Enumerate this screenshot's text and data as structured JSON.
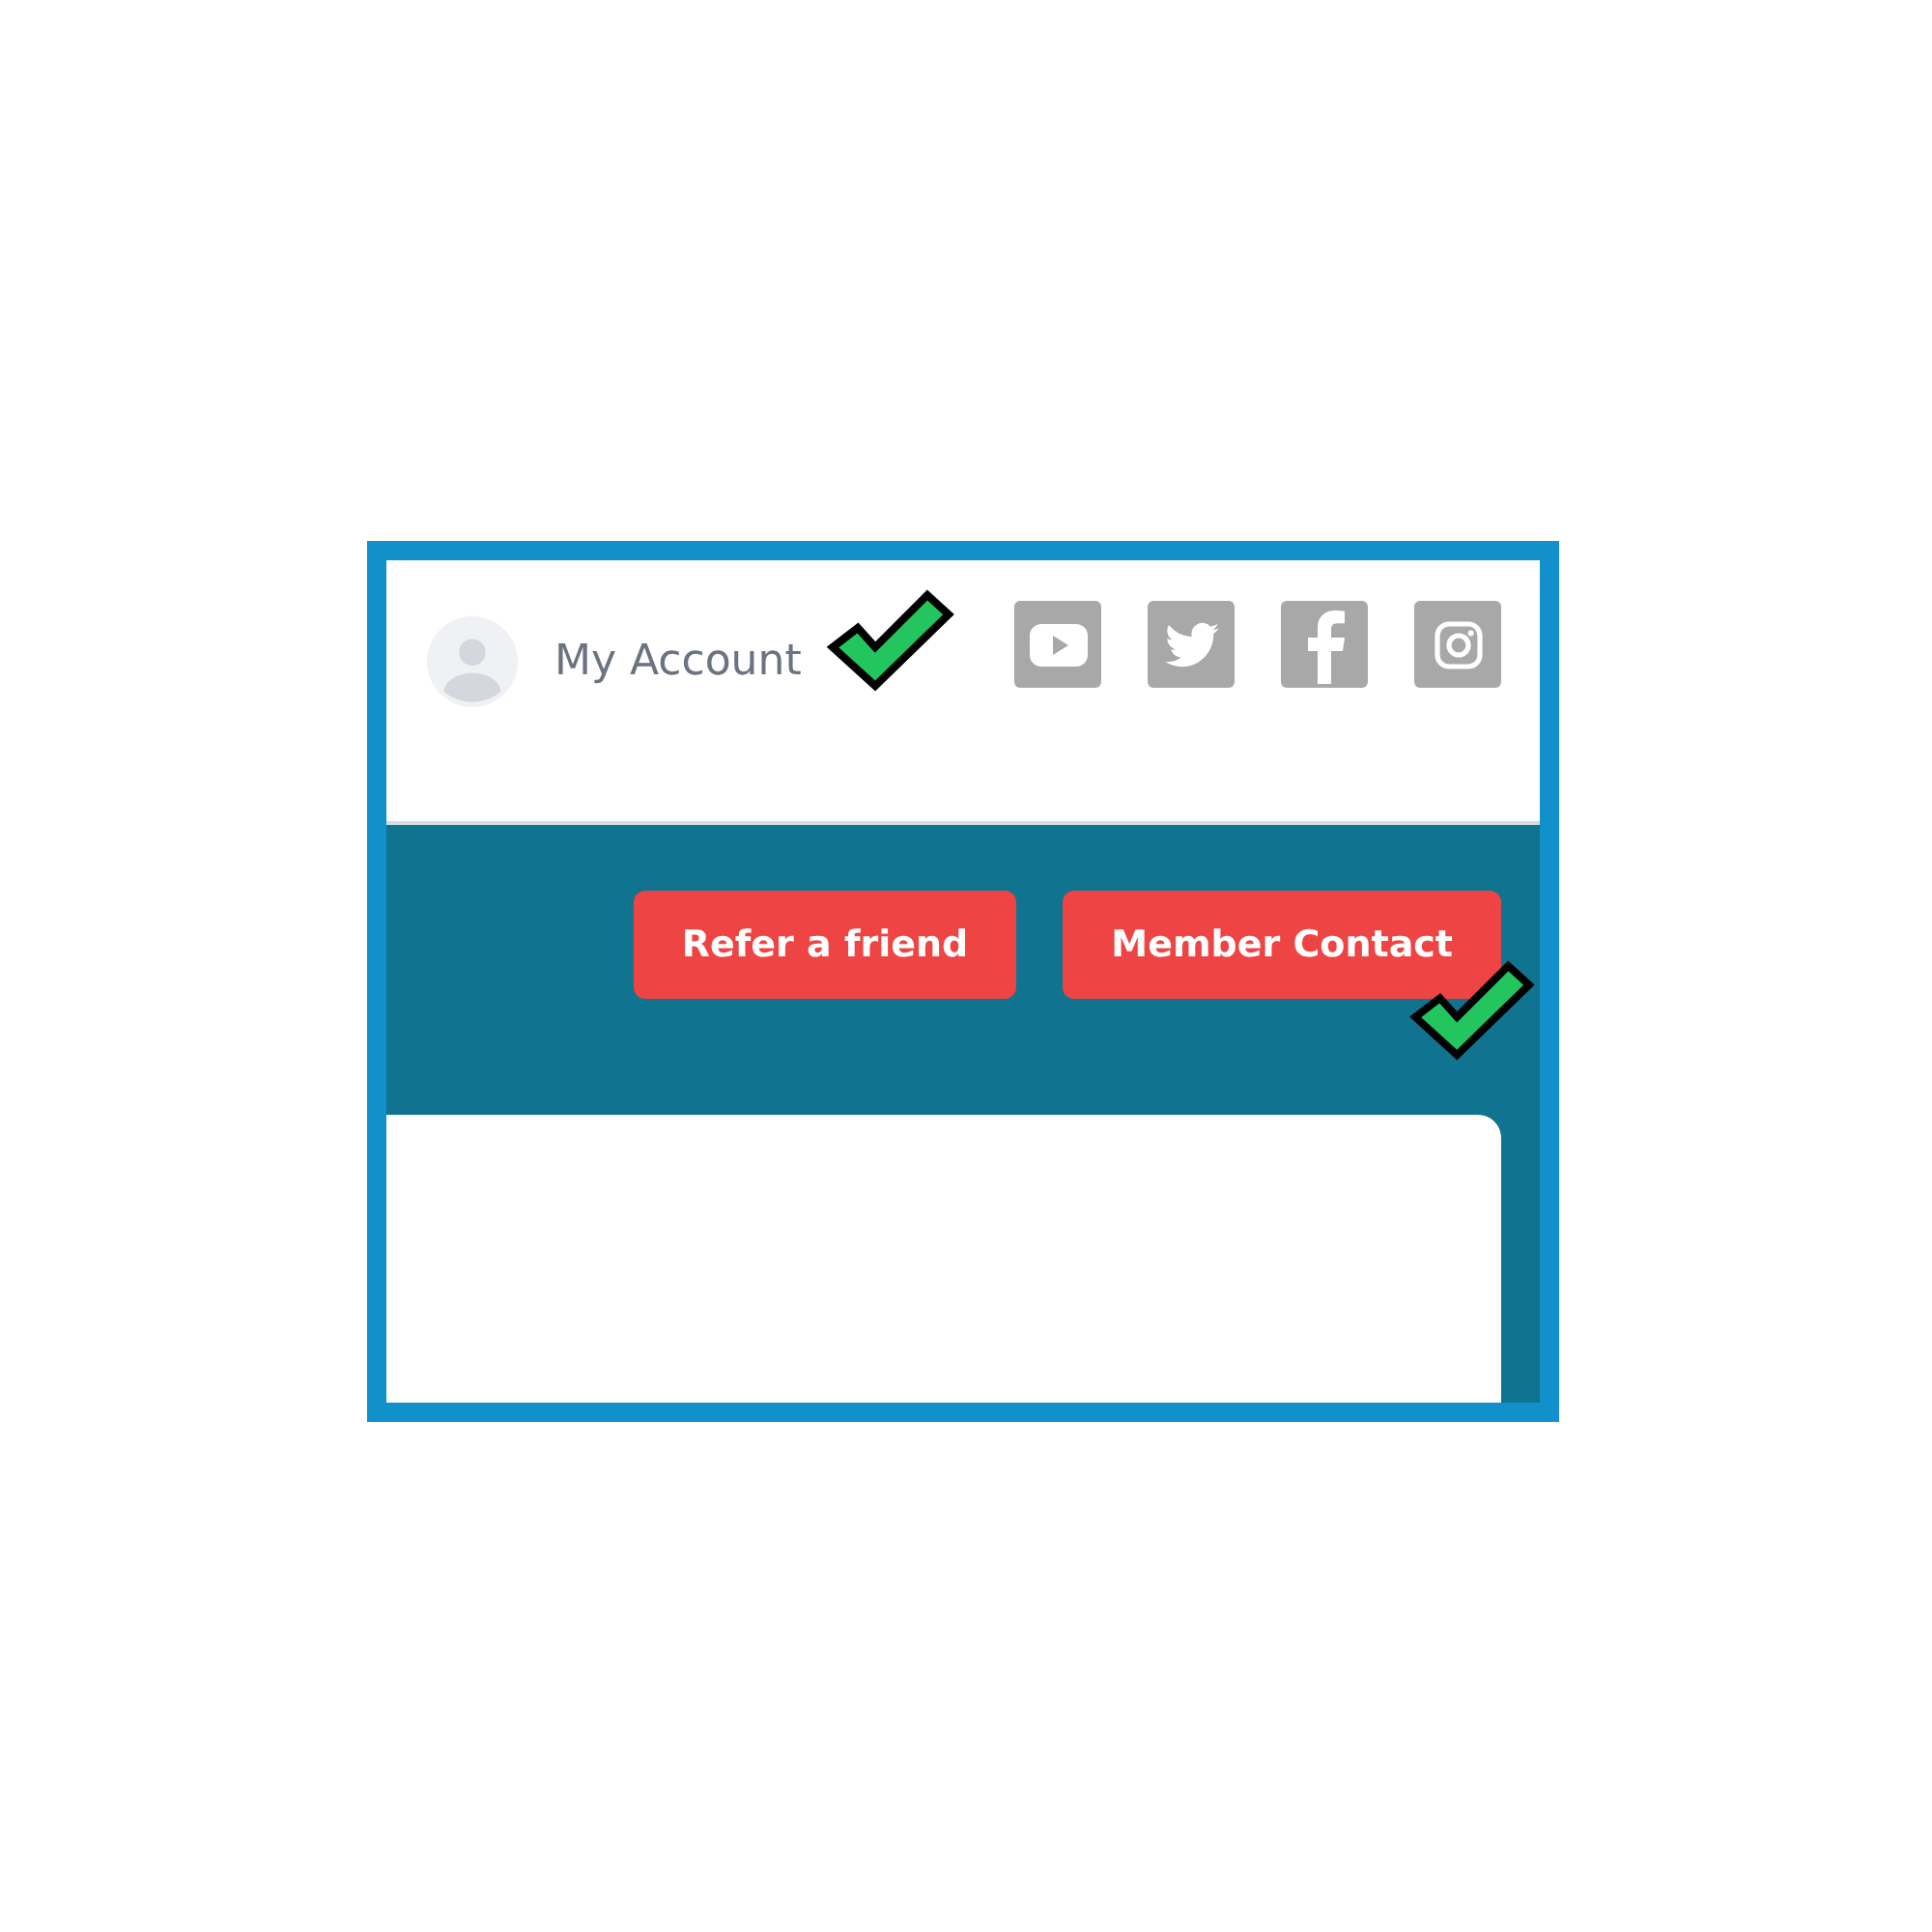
{
  "account": {
    "label": "My Account"
  },
  "social_links": [
    {
      "kind": "youtube"
    },
    {
      "kind": "twitter"
    },
    {
      "kind": "facebook"
    },
    {
      "kind": "instagram"
    }
  ],
  "buttons": [
    {
      "label": "Refer a friend"
    },
    {
      "label": "Member Contact"
    }
  ]
}
